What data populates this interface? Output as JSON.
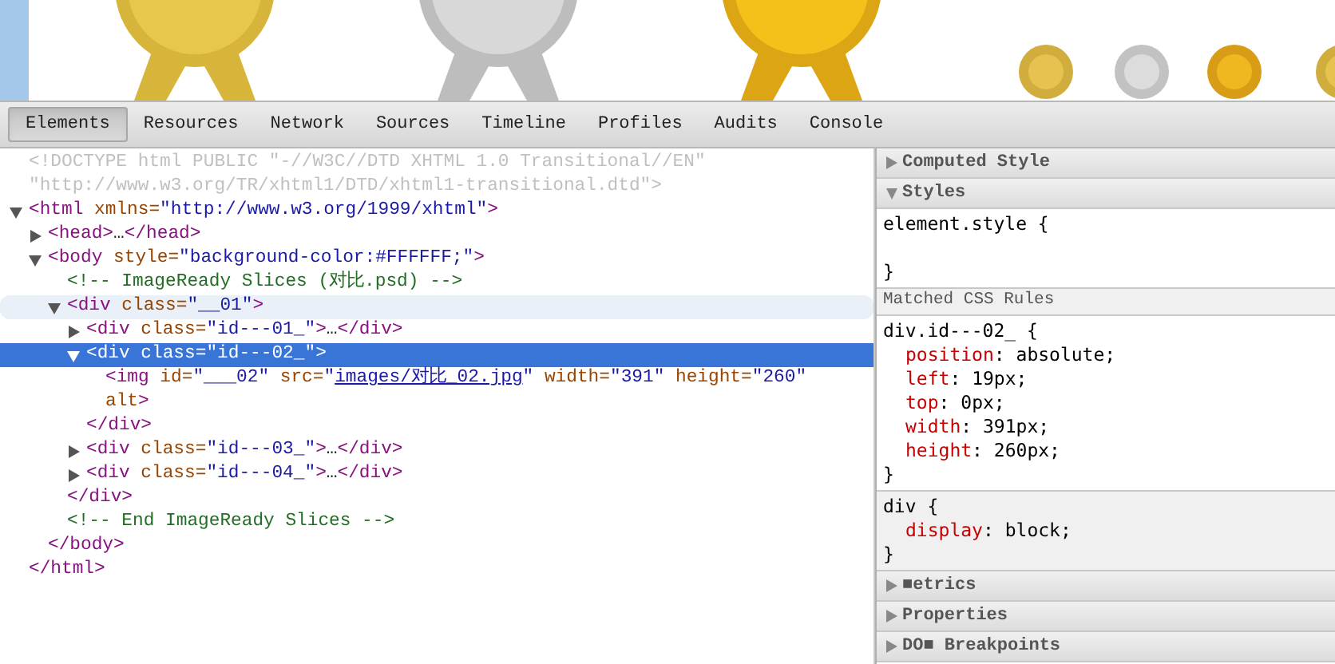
{
  "tabs": [
    {
      "label": "Elements",
      "selected": true
    },
    {
      "label": "Resources",
      "selected": false
    },
    {
      "label": "Network",
      "selected": false
    },
    {
      "label": "Sources",
      "selected": false
    },
    {
      "label": "Timeline",
      "selected": false
    },
    {
      "label": "Profiles",
      "selected": false
    },
    {
      "label": "Audits",
      "selected": false
    },
    {
      "label": "Console",
      "selected": false
    }
  ],
  "dom_tree": [
    {
      "kind": "leaf",
      "selected": false,
      "hovered": false,
      "tokens": [
        {
          "kind": "doctype",
          "text": "<!DOCTYPE html PUBLIC \"-//W3C//DTD XHTML 1.0 Transitional//EN\" \"http://www.w3.org/TR/xhtml1/DTD/xhtml1-transitional.dtd\">"
        }
      ]
    },
    {
      "kind": "expanded",
      "selected": false,
      "hovered": false,
      "tokens": [
        {
          "kind": "tag",
          "text": "<html"
        },
        {
          "kind": "attr",
          "text": " xmlns="
        },
        {
          "kind": "value",
          "text": "\"http://www.w3.org/1999/xhtml\""
        },
        {
          "kind": "tag",
          "text": ">"
        }
      ],
      "close": [
        {
          "kind": "tag",
          "text": "</html>"
        }
      ],
      "children": [
        {
          "kind": "collapsed",
          "selected": false,
          "hovered": false,
          "tokens": [
            {
              "kind": "tag",
              "text": "<head>"
            },
            {
              "kind": "ellipsis",
              "text": "…"
            },
            {
              "kind": "tag",
              "text": "</head>"
            }
          ]
        },
        {
          "kind": "expanded",
          "selected": false,
          "hovered": false,
          "tokens": [
            {
              "kind": "tag",
              "text": "<body"
            },
            {
              "kind": "attr",
              "text": " style="
            },
            {
              "kind": "value",
              "text": "\"background-color:#FFFFFF;\""
            },
            {
              "kind": "tag",
              "text": ">"
            }
          ],
          "close": [
            {
              "kind": "tag",
              "text": "</body>"
            }
          ],
          "children": [
            {
              "kind": "leaf",
              "selected": false,
              "hovered": false,
              "tokens": [
                {
                  "kind": "comment",
                  "text": "<!-- ImageReady Slices (对比.psd) -->"
                }
              ]
            },
            {
              "kind": "expanded",
              "selected": false,
              "hovered": true,
              "tokens": [
                {
                  "kind": "tag",
                  "text": "<div"
                },
                {
                  "kind": "attr",
                  "text": " class="
                },
                {
                  "kind": "value",
                  "text": "\"__01\""
                },
                {
                  "kind": "tag",
                  "text": ">"
                }
              ],
              "close": [
                {
                  "kind": "tag",
                  "text": "</div>"
                }
              ],
              "children": [
                {
                  "kind": "collapsed",
                  "selected": false,
                  "hovered": false,
                  "tokens": [
                    {
                      "kind": "tag",
                      "text": "<div"
                    },
                    {
                      "kind": "attr",
                      "text": " class="
                    },
                    {
                      "kind": "value",
                      "text": "\"id---01_\""
                    },
                    {
                      "kind": "tag",
                      "text": ">"
                    },
                    {
                      "kind": "ellipsis",
                      "text": "…"
                    },
                    {
                      "kind": "tag",
                      "text": "</div>"
                    }
                  ]
                },
                {
                  "kind": "expanded",
                  "selected": true,
                  "hovered": false,
                  "tokens": [
                    {
                      "kind": "tag",
                      "text": "<div"
                    },
                    {
                      "kind": "attr",
                      "text": " class="
                    },
                    {
                      "kind": "value",
                      "text": "\"id---02_\""
                    },
                    {
                      "kind": "tag",
                      "text": ">"
                    }
                  ],
                  "close": [
                    {
                      "kind": "tag",
                      "text": "</div>"
                    }
                  ],
                  "children": [
                    {
                      "kind": "leaf",
                      "selected": false,
                      "hovered": false,
                      "tokens": [
                        {
                          "kind": "tag",
                          "text": "<img"
                        },
                        {
                          "kind": "attr",
                          "text": " id="
                        },
                        {
                          "kind": "value",
                          "text": "\"___02\""
                        },
                        {
                          "kind": "attr",
                          "text": " src="
                        },
                        {
                          "kind": "value",
                          "text": "\""
                        },
                        {
                          "kind": "link",
                          "text": "images/对比_02.jpg"
                        },
                        {
                          "kind": "value",
                          "text": "\""
                        },
                        {
                          "kind": "attr",
                          "text": " width="
                        },
                        {
                          "kind": "value",
                          "text": "\"391\""
                        },
                        {
                          "kind": "attr",
                          "text": " height="
                        },
                        {
                          "kind": "value",
                          "text": "\"260\""
                        },
                        {
                          "kind": "attr",
                          "text": " alt"
                        },
                        {
                          "kind": "tag",
                          "text": ">"
                        }
                      ]
                    }
                  ]
                },
                {
                  "kind": "collapsed",
                  "selected": false,
                  "hovered": false,
                  "tokens": [
                    {
                      "kind": "tag",
                      "text": "<div"
                    },
                    {
                      "kind": "attr",
                      "text": " class="
                    },
                    {
                      "kind": "value",
                      "text": "\"id---03_\""
                    },
                    {
                      "kind": "tag",
                      "text": ">"
                    },
                    {
                      "kind": "ellipsis",
                      "text": "…"
                    },
                    {
                      "kind": "tag",
                      "text": "</div>"
                    }
                  ]
                },
                {
                  "kind": "collapsed",
                  "selected": false,
                  "hovered": false,
                  "tokens": [
                    {
                      "kind": "tag",
                      "text": "<div"
                    },
                    {
                      "kind": "attr",
                      "text": " class="
                    },
                    {
                      "kind": "value",
                      "text": "\"id---04_\""
                    },
                    {
                      "kind": "tag",
                      "text": ">"
                    },
                    {
                      "kind": "ellipsis",
                      "text": "…"
                    },
                    {
                      "kind": "tag",
                      "text": "</div>"
                    }
                  ]
                }
              ]
            },
            {
              "kind": "leaf",
              "selected": false,
              "hovered": false,
              "tokens": [
                {
                  "kind": "comment",
                  "text": "<!-- End ImageReady Slices -->"
                }
              ]
            }
          ]
        }
      ]
    }
  ],
  "sidebar": [
    {
      "kind": "section",
      "title": "Computed Style",
      "expanded": false
    },
    {
      "kind": "section",
      "title": "Styles",
      "expanded": true
    },
    {
      "kind": "rule",
      "user_agent": false,
      "selector": "element.style {",
      "end": "}"
    },
    {
      "kind": "subheader",
      "title": "Matched CSS Rules"
    },
    {
      "kind": "rule",
      "user_agent": false,
      "selector": "div.id---02_ {",
      "properties": [
        {
          "name": "position",
          "punct": ":",
          "value": "absolute;"
        },
        {
          "name": "left",
          "punct": ":",
          "value": "19px;"
        },
        {
          "name": "top",
          "punct": ":",
          "value": "0px;"
        },
        {
          "name": "width",
          "punct": ":",
          "value": "391px;"
        },
        {
          "name": "height",
          "punct": ":",
          "value": "260px;"
        }
      ],
      "end": "}"
    },
    {
      "kind": "rule",
      "user_agent": true,
      "selector": "div {",
      "properties": [
        {
          "name": "display",
          "punct": ":",
          "value": "block;"
        }
      ],
      "end": "}"
    },
    {
      "kind": "section",
      "title": "■etrics",
      "expanded": false
    },
    {
      "kind": "section",
      "title": "Properties",
      "expanded": false
    },
    {
      "kind": "section",
      "title": "DO■ Breakpoints",
      "expanded": false
    }
  ]
}
